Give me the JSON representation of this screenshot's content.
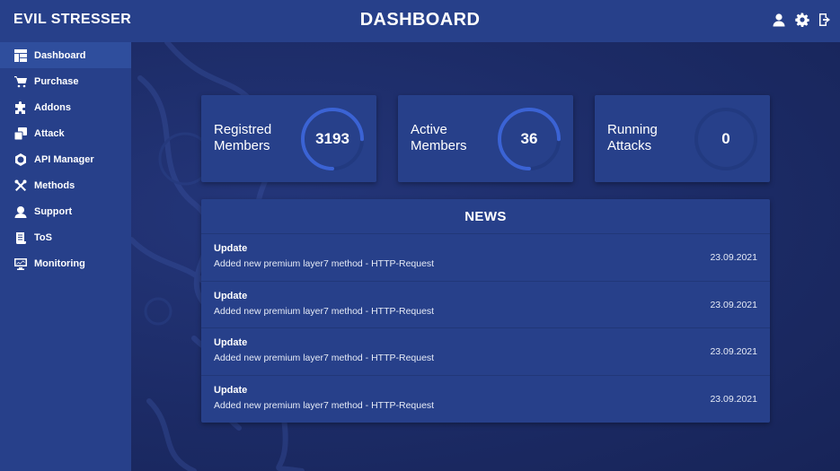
{
  "brand": "EVIL STRESSER",
  "page_title": "DASHBOARD",
  "colors": {
    "sidebar_bg": "#27408a",
    "main_bg": "#1c2c66",
    "ring_fill": "#3b63d4",
    "ring_track": "#223a80"
  },
  "top_icons": [
    "user-icon",
    "gear-icon",
    "logout-icon"
  ],
  "sidebar": {
    "items": [
      {
        "label": "Dashboard",
        "icon": "dashboard-icon",
        "active": true
      },
      {
        "label": "Purchase",
        "icon": "cart-icon",
        "active": false
      },
      {
        "label": "Addons",
        "icon": "puzzle-icon",
        "active": false
      },
      {
        "label": "Attack",
        "icon": "attack-icon",
        "active": false
      },
      {
        "label": "API Manager",
        "icon": "api-icon",
        "active": false
      },
      {
        "label": "Methods",
        "icon": "tools-icon",
        "active": false
      },
      {
        "label": "Support",
        "icon": "support-icon",
        "active": false
      },
      {
        "label": "ToS",
        "icon": "scroll-icon",
        "active": false
      },
      {
        "label": "Monitoring",
        "icon": "monitor-icon",
        "active": false
      }
    ]
  },
  "stats": [
    {
      "label": "Registred Members",
      "value": "3193",
      "ring_fraction": 0.75
    },
    {
      "label": "Active Members",
      "value": "36",
      "ring_fraction": 0.75
    },
    {
      "label": "Running Attacks",
      "value": "0",
      "ring_fraction": 0
    }
  ],
  "news": {
    "title": "NEWS",
    "items": [
      {
        "title": "Update",
        "text": "Added new premium layer7 method - HTTP-Request",
        "date": "23.09.2021"
      },
      {
        "title": "Update",
        "text": "Added new premium layer7 method - HTTP-Request",
        "date": "23.09.2021"
      },
      {
        "title": "Update",
        "text": "Added new premium layer7 method - HTTP-Request",
        "date": "23.09.2021"
      },
      {
        "title": "Update",
        "text": "Added new premium layer7 method - HTTP-Request",
        "date": "23.09.2021"
      }
    ]
  }
}
